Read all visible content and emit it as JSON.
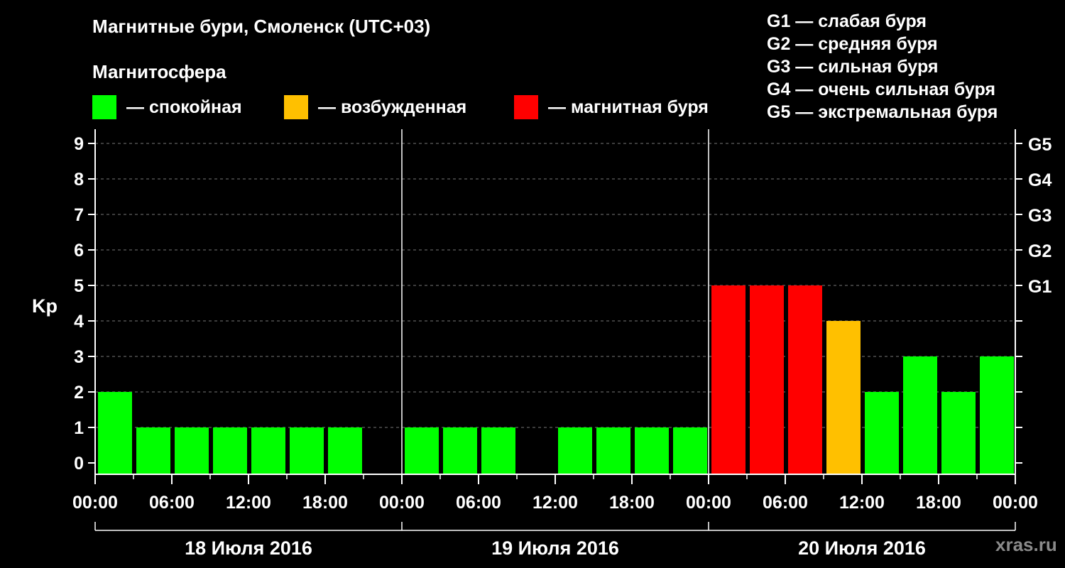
{
  "title": "Магнитные бури, Смоленск (UTC+03)",
  "subtitle": "Магнитосфера",
  "legend": [
    {
      "color": "#00ff00",
      "label": "— спокойная"
    },
    {
      "color": "#ffc000",
      "label": "— возбужденная"
    },
    {
      "color": "#ff0000",
      "label": "— магнитная буря"
    }
  ],
  "g_legend": [
    "G1 — слабая буря",
    "G2 — средняя буря",
    "G3 — сильная буря",
    "G4 — очень сильная буря",
    "G5 — экстремальная буря"
  ],
  "watermark": "xras.ru",
  "chart_data": {
    "type": "bar",
    "ylabel": "Kp",
    "ylim": [
      0,
      9
    ],
    "y_ticks": [
      0,
      1,
      2,
      3,
      4,
      5,
      6,
      7,
      8,
      9
    ],
    "right_ticks": [
      {
        "value": 5,
        "label": "G1"
      },
      {
        "value": 6,
        "label": "G2"
      },
      {
        "value": 7,
        "label": "G3"
      },
      {
        "value": 8,
        "label": "G4"
      },
      {
        "value": 9,
        "label": "G5"
      }
    ],
    "x_tick_labels": [
      "00:00",
      "06:00",
      "12:00",
      "18:00",
      "00:00",
      "06:00",
      "12:00",
      "18:00",
      "00:00",
      "06:00",
      "12:00",
      "18:00",
      "00:00"
    ],
    "days": [
      "18 Июля 2016",
      "19 Июля 2016",
      "20 Июля 2016"
    ],
    "interval_hours": 3,
    "values": [
      2,
      1,
      1,
      1,
      1,
      1,
      1,
      null,
      1,
      1,
      1,
      null,
      1,
      1,
      1,
      1,
      5,
      5,
      5,
      4,
      2,
      3,
      2,
      3
    ],
    "colors": {
      "quiet": "#00ff00",
      "active": "#ffc000",
      "storm": "#ff0000"
    },
    "grid": true
  }
}
